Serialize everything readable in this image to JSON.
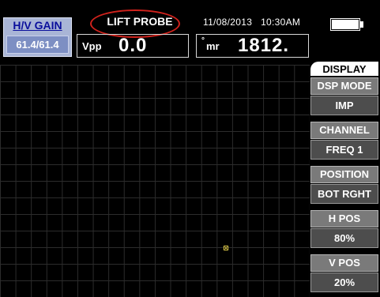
{
  "gain": {
    "title": "H/V GAIN",
    "value": "61.4/61.4"
  },
  "status": {
    "message": "LIFT PROBE"
  },
  "datetime": {
    "date": "11/08/2013",
    "time": "10:30AM"
  },
  "readouts": {
    "vpp": {
      "label": "Vpp",
      "value": "0.0"
    },
    "mr": {
      "degree": "°",
      "label": "mr",
      "value": "1812."
    }
  },
  "menu": {
    "title": "DISPLAY",
    "items": [
      {
        "label": "DSP MODE",
        "value": "IMP"
      },
      {
        "label": "CHANNEL",
        "value": "FREQ 1"
      },
      {
        "label": "POSITION",
        "value": "BOT RGHT"
      },
      {
        "label": "H POS",
        "value": "80%"
      },
      {
        "label": "V POS",
        "value": "20%"
      }
    ]
  },
  "colors": {
    "background": "#000000",
    "gain_box": "#a9b5d6",
    "gain_title": "#0a0f9c",
    "highlight_ellipse": "#d0221c",
    "cursor": "#e7d24a",
    "menu_label": "#7a7a7a",
    "menu_value": "#4d4d4d"
  },
  "icons": {
    "battery": "battery-icon",
    "cursor": "dot-cursor-icon"
  }
}
